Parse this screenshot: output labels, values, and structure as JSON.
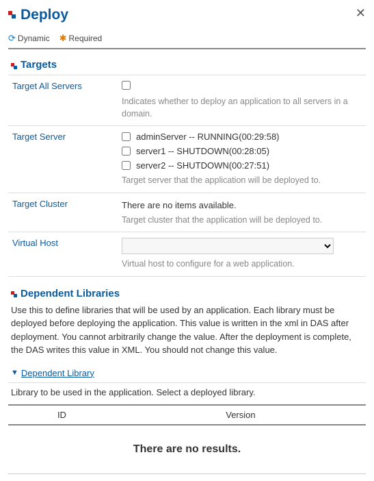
{
  "header": {
    "title": "Deploy"
  },
  "legend": {
    "dynamic": "Dynamic",
    "required": "Required"
  },
  "sections": {
    "targets": {
      "title": "Targets",
      "rows": {
        "target_all": {
          "label": "Target All Servers",
          "help": "Indicates whether to deploy an application to all servers in a domain."
        },
        "target_server": {
          "label": "Target Server",
          "items": [
            "adminServer -- RUNNING(00:29:58)",
            "server1 -- SHUTDOWN(00:28:05)",
            "server2 -- SHUTDOWN(00:27:51)"
          ],
          "help": "Target server that the application will be deployed to."
        },
        "target_cluster": {
          "label": "Target Cluster",
          "value": "There are no items available.",
          "help": "Target cluster that the application will be deployed to."
        },
        "virtual_host": {
          "label": "Virtual Host",
          "selected": "",
          "help": "Virtual host to configure for a web application."
        }
      }
    },
    "dependent": {
      "title": "Dependent Libraries",
      "desc": "Use this to define libraries that will be used by an application. Each library must be deployed before deploying the application. This value is written in the xml in DAS after deployment. You cannot arbitrarily change the value. After the deployment is complete, the DAS writes this value in XML. You should not change this value.",
      "sub_link": "Dependent Library",
      "sub_desc": "Library to be used in the application. Select a deployed library.",
      "table": {
        "columns": [
          "ID",
          "Version"
        ],
        "empty": "There are no results."
      }
    }
  }
}
